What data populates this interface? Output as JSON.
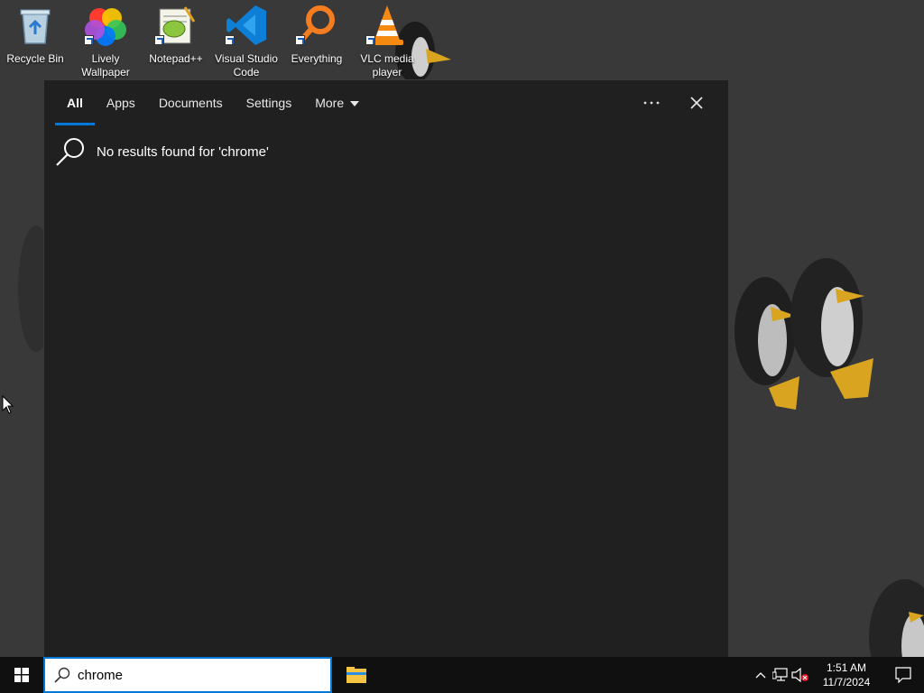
{
  "desktop": {
    "icons": [
      {
        "label": "Recycle Bin",
        "icon": "recycle-bin-icon"
      },
      {
        "label": "Lively\nWallpaper",
        "icon": "lively-wallpaper-icon"
      },
      {
        "label": "Notepad++",
        "icon": "notepad-plus-plus-icon"
      },
      {
        "label": "Visual Studio\nCode",
        "icon": "vscode-icon"
      },
      {
        "label": "Everything",
        "icon": "everything-icon"
      },
      {
        "label": "VLC media\nplayer",
        "icon": "vlc-icon"
      }
    ]
  },
  "search": {
    "tabs": [
      {
        "label": "All",
        "active": true
      },
      {
        "label": "Apps"
      },
      {
        "label": "Documents"
      },
      {
        "label": "Settings"
      },
      {
        "label": "More"
      }
    ],
    "no_results": "No results found for 'chrome'",
    "query": "chrome"
  },
  "taskbar": {
    "time": "1:51 AM",
    "date": "11/7/2024"
  },
  "colors": {
    "accent": "#0078d7",
    "panel": "#202020",
    "taskbar": "#101010"
  }
}
